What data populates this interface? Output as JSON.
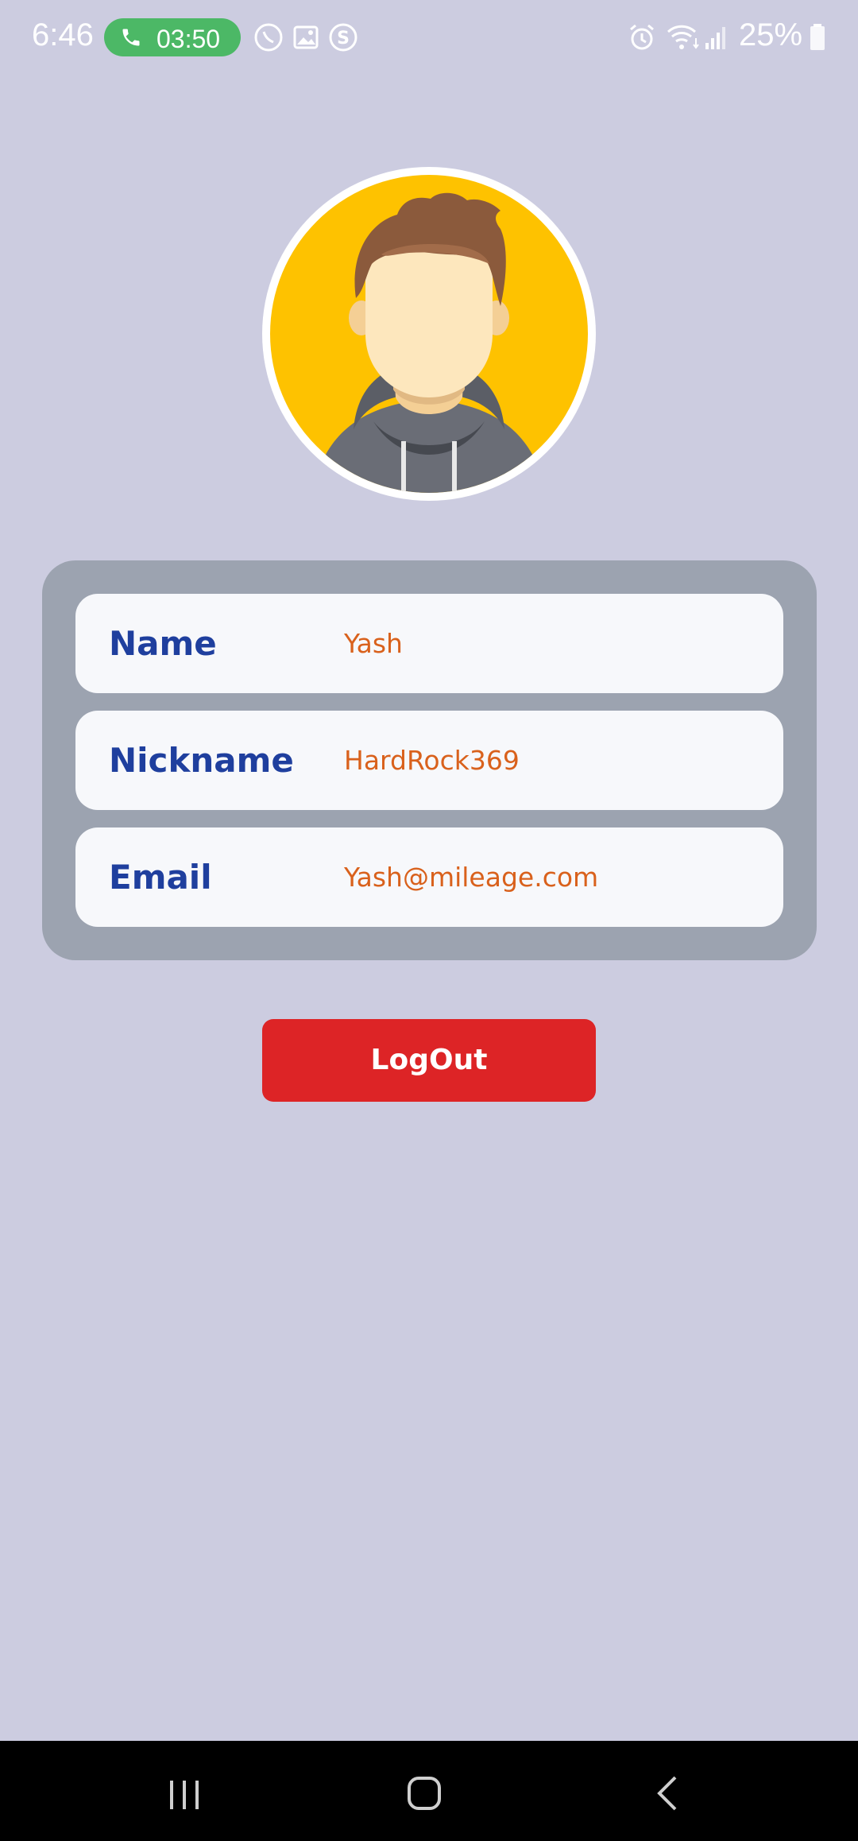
{
  "status_bar": {
    "time": "6:46",
    "call_timer": "03:50",
    "battery_percent": "25%",
    "icons": [
      "phone-icon",
      "viber-icon",
      "gallery-icon",
      "shazam-icon",
      "alarm-icon",
      "wifi-icon",
      "signal-icon",
      "battery-icon"
    ],
    "call_pill_color": "#4cb866"
  },
  "profile": {
    "avatar_icon": "user-avatar-icon",
    "fields": [
      {
        "label": "Name",
        "value": "Yash"
      },
      {
        "label": "Nickname",
        "value": "HardRock369"
      },
      {
        "label": "Email",
        "value": "Yash@mileage.com"
      }
    ]
  },
  "actions": {
    "logout_label": "LogOut"
  },
  "colors": {
    "background": "#cccce0",
    "card": "#9ca3b0",
    "label": "#1f3f9e",
    "value": "#d9611c",
    "logout": "#dd2426"
  },
  "nav_bar": {
    "buttons": [
      "recents-icon",
      "home-icon",
      "back-icon"
    ]
  }
}
